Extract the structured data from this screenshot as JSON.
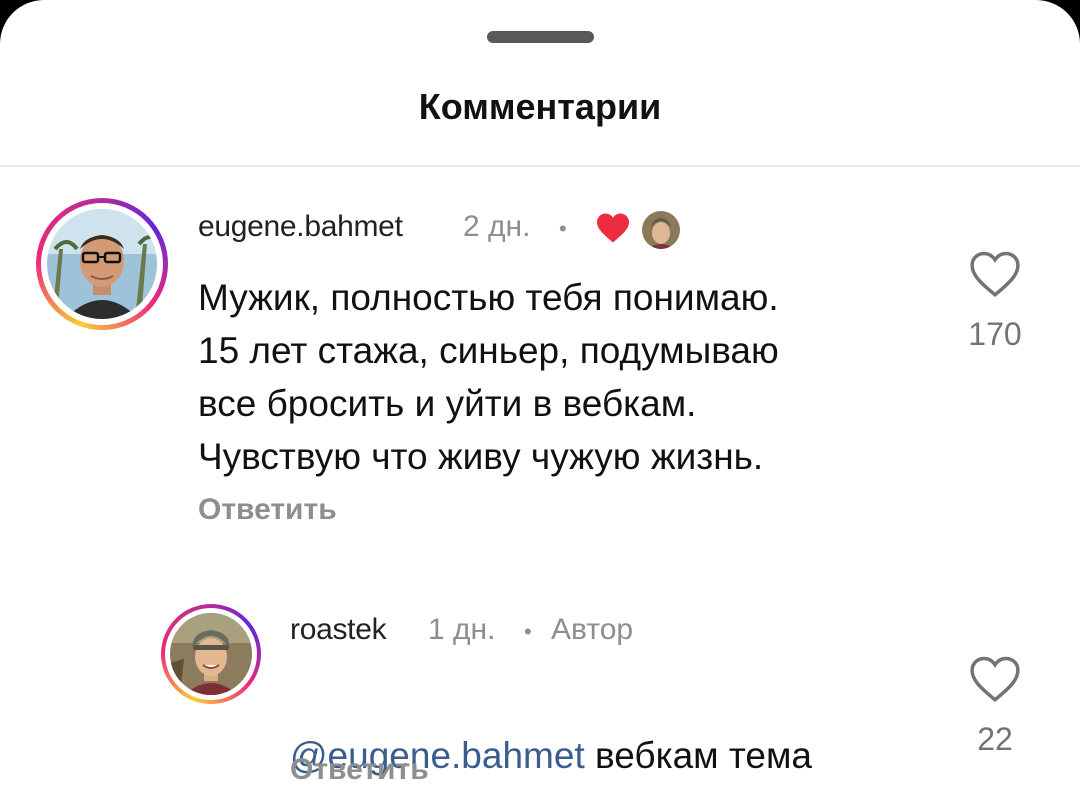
{
  "header": {
    "title": "Комментарии"
  },
  "comments": [
    {
      "username": "eugene.bahmet",
      "time": "2 дн.",
      "dot": "•",
      "author_liked": true,
      "text": "Мужик, полностью тебя понимаю.\n15 лет стажа, синьер, подумываю\nвсе бросить и уйти в вебкам.\nЧувствую что живу чужую жизнь.",
      "reply_label": "Ответить",
      "likes": "170"
    },
    {
      "username": "roastek",
      "time": "1 дн.",
      "dot": "•",
      "badge": "Автор",
      "mention": "@eugene.bahmet",
      "text": " вебкам тема",
      "reply_label": "Ответить",
      "likes": "22"
    }
  ],
  "colors": {
    "liked_heart": "#ed2d3f",
    "mention": "#3b5c8c",
    "secondary_text": "#8e8e8e"
  },
  "icons": [
    "heart-outline-icon",
    "heart-filled-icon"
  ]
}
